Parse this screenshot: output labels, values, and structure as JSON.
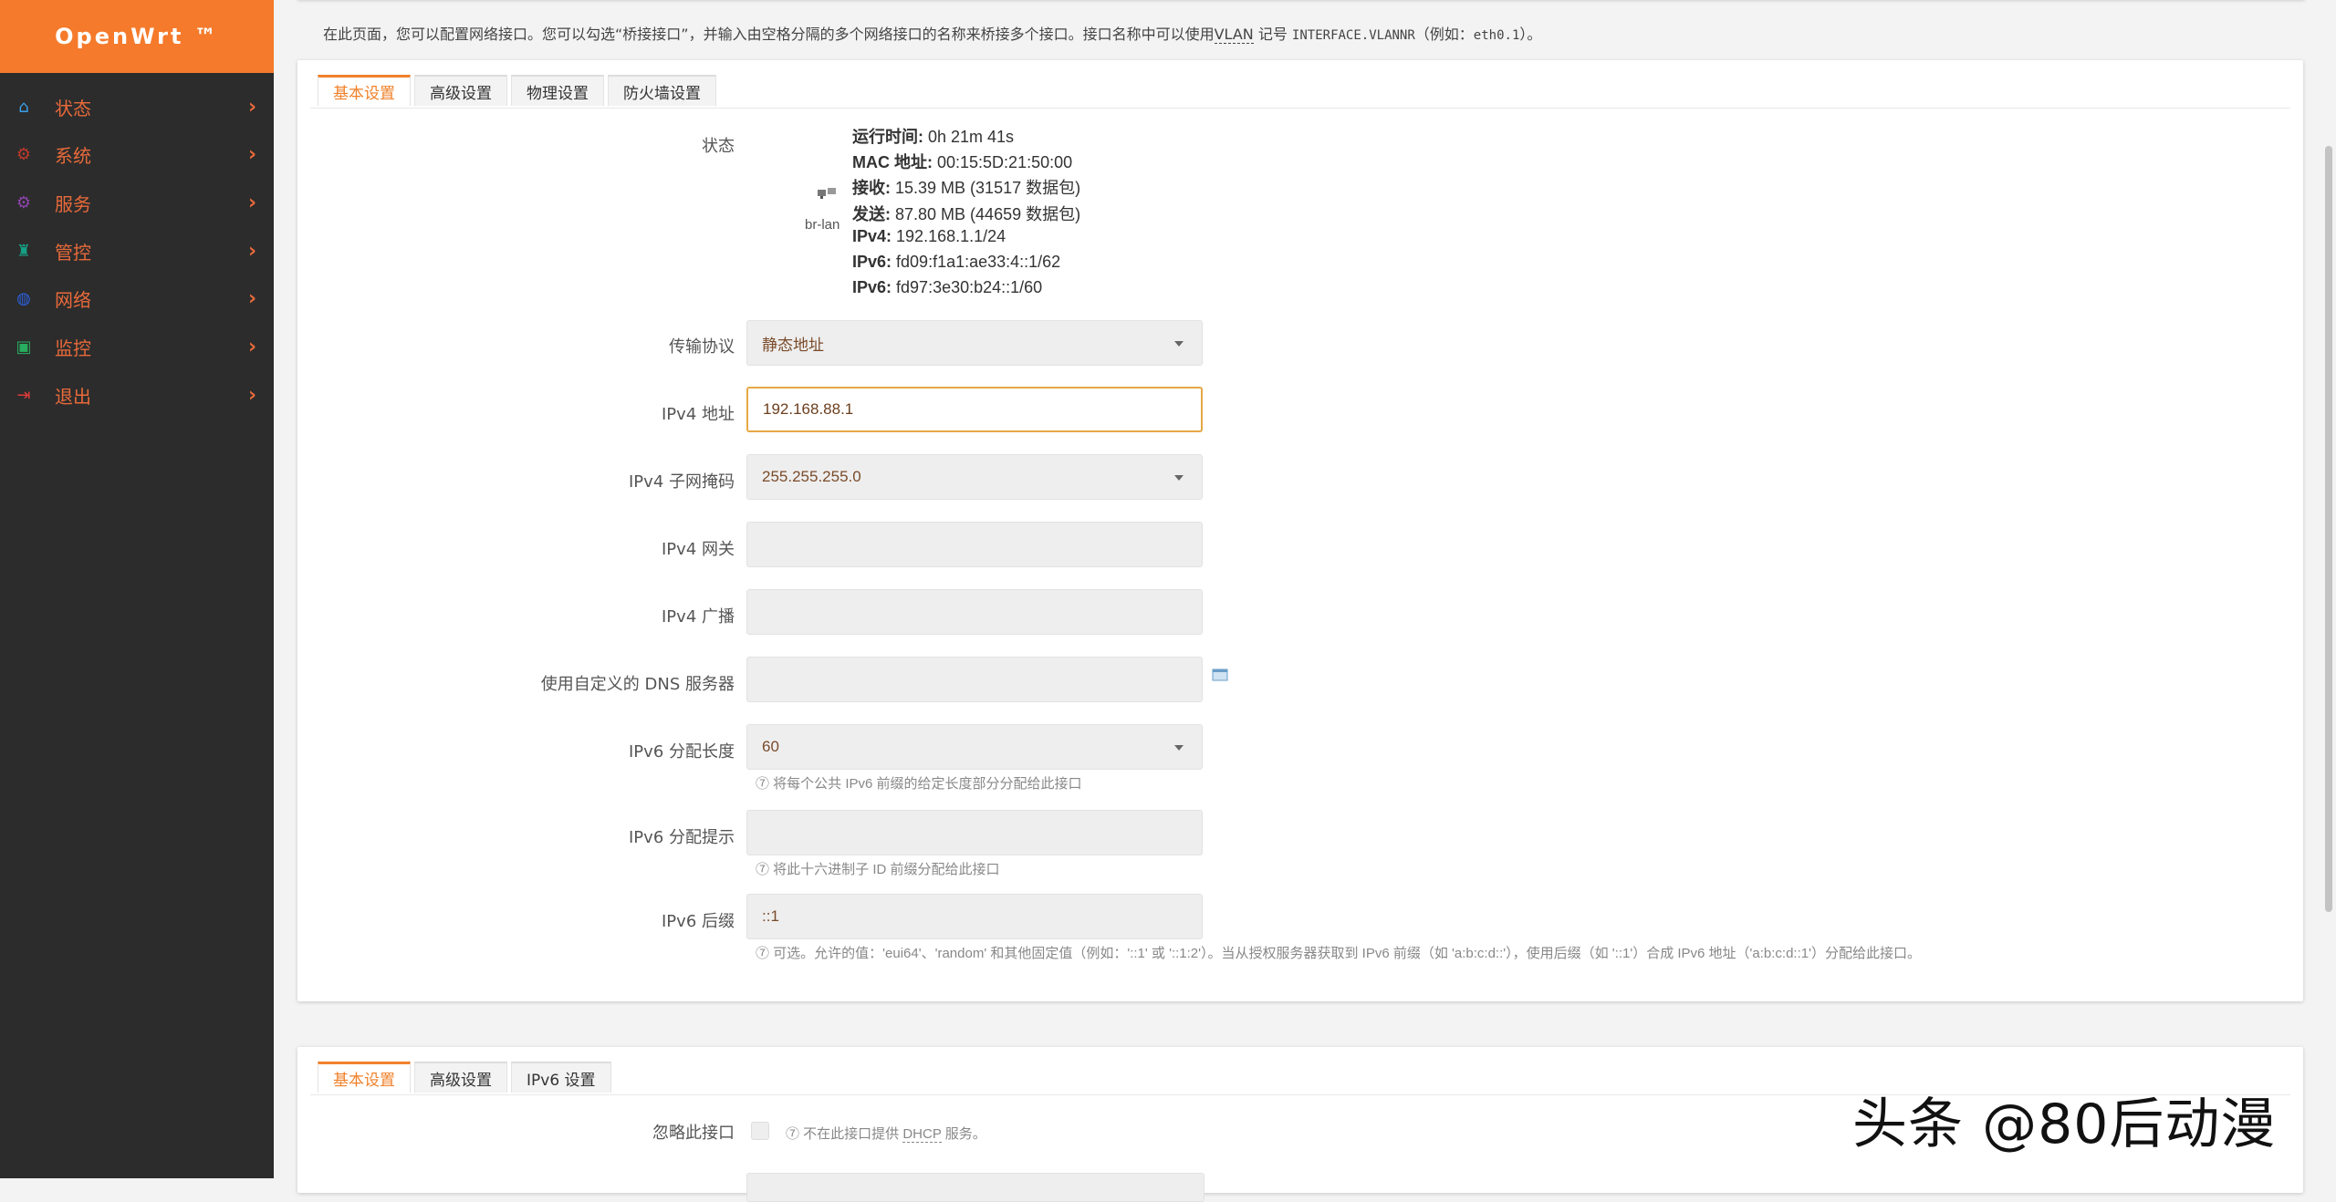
{
  "brand": "OpenWrt ™",
  "sidebar": {
    "items": [
      {
        "label": "状态",
        "icon": "home-icon",
        "color": "#3aa0e8"
      },
      {
        "label": "系统",
        "icon": "gear-icon",
        "color": "#c0392b"
      },
      {
        "label": "服务",
        "icon": "services-gear-icon",
        "color": "#8e44ad"
      },
      {
        "label": "管控",
        "icon": "control-icon",
        "color": "#16a085"
      },
      {
        "label": "网络",
        "icon": "network-globe-icon",
        "color": "#2c60e0"
      },
      {
        "label": "监控",
        "icon": "monitor-icon",
        "color": "#27ae60"
      },
      {
        "label": "退出",
        "icon": "logout-icon",
        "color": "#e03a3a"
      }
    ],
    "chevron": "›"
  },
  "top_note": {
    "text_before": "在此页面，您可以配置网络接口。您可以勾选“桥接接口”，并输入由空格分隔的多个网络接口的名称来桥接多个接口。接口名称中可以使用",
    "vlan": "VLAN",
    "text_mid": " 记号 ",
    "code": "INTERFACE.VLANNR",
    "text_after": "（例如：",
    "example": "eth0.1",
    "text_end": "）。"
  },
  "card1": {
    "tabs": [
      "基本设置",
      "高级设置",
      "物理设置",
      "防火墙设置"
    ],
    "status_label": "状态",
    "iface_name": "br-lan",
    "status_lines": [
      {
        "key": "运行时间:",
        "value": " 0h 21m 41s"
      },
      {
        "key": "MAC 地址:",
        "value": " 00:15:5D:21:50:00"
      },
      {
        "key": "接收:",
        "value": " 15.39 MB (31517 数据包)"
      },
      {
        "key": "发送:",
        "value": " 87.80 MB (44659 数据包)"
      },
      {
        "key": "IPv4:",
        "value": " 192.168.1.1/24"
      },
      {
        "key": "IPv6:",
        "value": " fd09:f1a1:ae33:4::1/62"
      },
      {
        "key": "IPv6:",
        "value": " fd97:3e30:b24::1/60"
      }
    ],
    "protocol_label": "传输协议",
    "protocol_value": "静态地址",
    "ipv4_addr_label": "IPv4 地址",
    "ipv4_addr_value": "192.168.88.1",
    "netmask_label": "IPv4 子网掩码",
    "netmask_value": "255.255.255.0",
    "gateway_label": "IPv4 网关",
    "gateway_value": "",
    "broadcast_label": "IPv4 广播",
    "broadcast_value": "",
    "dns_label": "使用自定义的 DNS 服务器",
    "dns_value": "",
    "ip6assign_label": "IPv6 分配长度",
    "ip6assign_value": "60",
    "ip6assign_hint": "⑦ 将每个公共 IPv6 前缀的给定长度部分分配给此接口",
    "ip6hint_label": "IPv6 分配提示",
    "ip6hint_value": "",
    "ip6hint_hint": "⑦ 将此十六进制子 ID 前缀分配给此接口",
    "ip6suffix_label": "IPv6 后缀",
    "ip6suffix_value": "::1",
    "ip6suffix_hint": "⑦ 可选。允许的值：'eui64'、'random' 和其他固定值（例如：'::1' 或 '::1:2'）。当从授权服务器获取到 IPv6 前缀（如 'a:b:c:d::'），使用后缀（如 '::1'）合成 IPv6 地址（'a:b:c:d::1'）分配给此接口。"
  },
  "card2": {
    "tabs": [
      "基本设置",
      "高级设置",
      "IPv6 设置"
    ],
    "ignore_label": "忽略此接口",
    "ignore_hint_before": "⑦ 不在此接口提供 ",
    "ignore_hint_dhcp": "DHCP",
    "ignore_hint_after": " 服务。"
  },
  "watermark": "头条 @80后动漫",
  "colors": {
    "accent": "#f0812a",
    "sidebar_bg": "#2c2c2c",
    "brand_bg": "#f57a2b"
  }
}
